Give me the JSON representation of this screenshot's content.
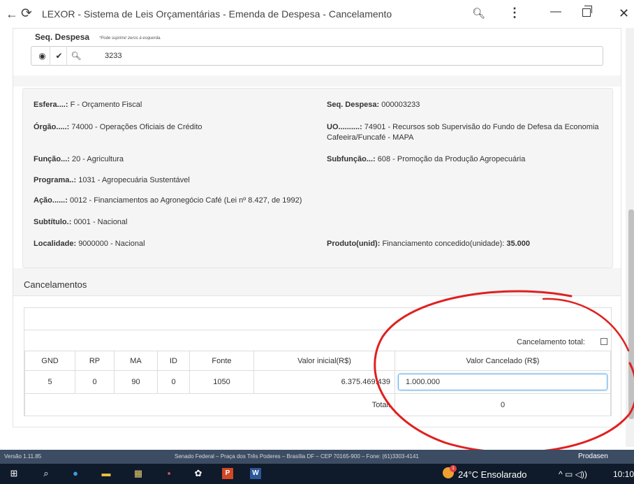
{
  "window": {
    "title": "LEXOR - Sistema de Leis Orçamentárias - Emenda de Despesa - Cancelamento"
  },
  "seq": {
    "label": "Seq. Despesa",
    "hint": "*Pode suprimir zeros à esquerda.",
    "value": "3233"
  },
  "info": {
    "esfera_label": "Esfera....:",
    "esfera_value": "F - Orçamento Fiscal",
    "seq_label": "Seq. Despesa:",
    "seq_value": "000003233",
    "orgao_label": "Órgão.....:",
    "orgao_value": "74000 - Operações Oficiais de Crédito",
    "uo_label": "UO..........:",
    "uo_value": "74901 - Recursos sob Supervisão do Fundo de Defesa da Economia Cafeeira/Funcafé - MAPA",
    "funcao_label": "Função...:",
    "funcao_value": "20 - Agricultura",
    "subfuncao_label": "Subfunção...:",
    "subfuncao_value": "608 - Promoção da Produção Agropecuária",
    "programa_label": "Programa..:",
    "programa_value": "1031 - Agropecuária Sustentável",
    "acao_label": "Ação......:",
    "acao_value": "0012 - Financiamentos ao Agronegócio Café (Lei nº 8.427, de 1992)",
    "subtitulo_label": "Subtítulo.:",
    "subtitulo_value": "0001 - Nacional",
    "localidade_label": "Localidade:",
    "localidade_value": "9000000 - Nacional",
    "produto_label": "Produto(unid):",
    "produto_value": "Financiamento concedido(unidade):",
    "produto_qty": "35.000"
  },
  "cancelamentos": {
    "title": "Cancelamentos",
    "total_label": "Cancelamento total:",
    "headers": [
      "GND",
      "RP",
      "MA",
      "ID",
      "Fonte",
      "Valor inicial(R$)",
      "Valor Cancelado (R$)"
    ],
    "row": {
      "gnd": "5",
      "rp": "0",
      "ma": "90",
      "id": "0",
      "fonte": "1050",
      "valor_inicial": "6.375.469.439",
      "valor_cancelado": "1.000.000"
    },
    "total_row_label": "Total:",
    "total_value": "0"
  },
  "footer": {
    "version": "Versão 1.11.85",
    "address": "Senado Federal – Praça dos Três Poderes – Brasília DF – CEP 70165-900 – Fone: (61)3303-4141",
    "logo": "Prodasen"
  },
  "taskbar": {
    "badge": "1",
    "weather": "24°C  Ensolarado",
    "clock": "10:10"
  },
  "colors": {
    "annotation": "#e02020",
    "footer_bg": "#3b4c63",
    "taskbar_bg": "#0f1a2a",
    "input_focus": "#66afe9"
  }
}
